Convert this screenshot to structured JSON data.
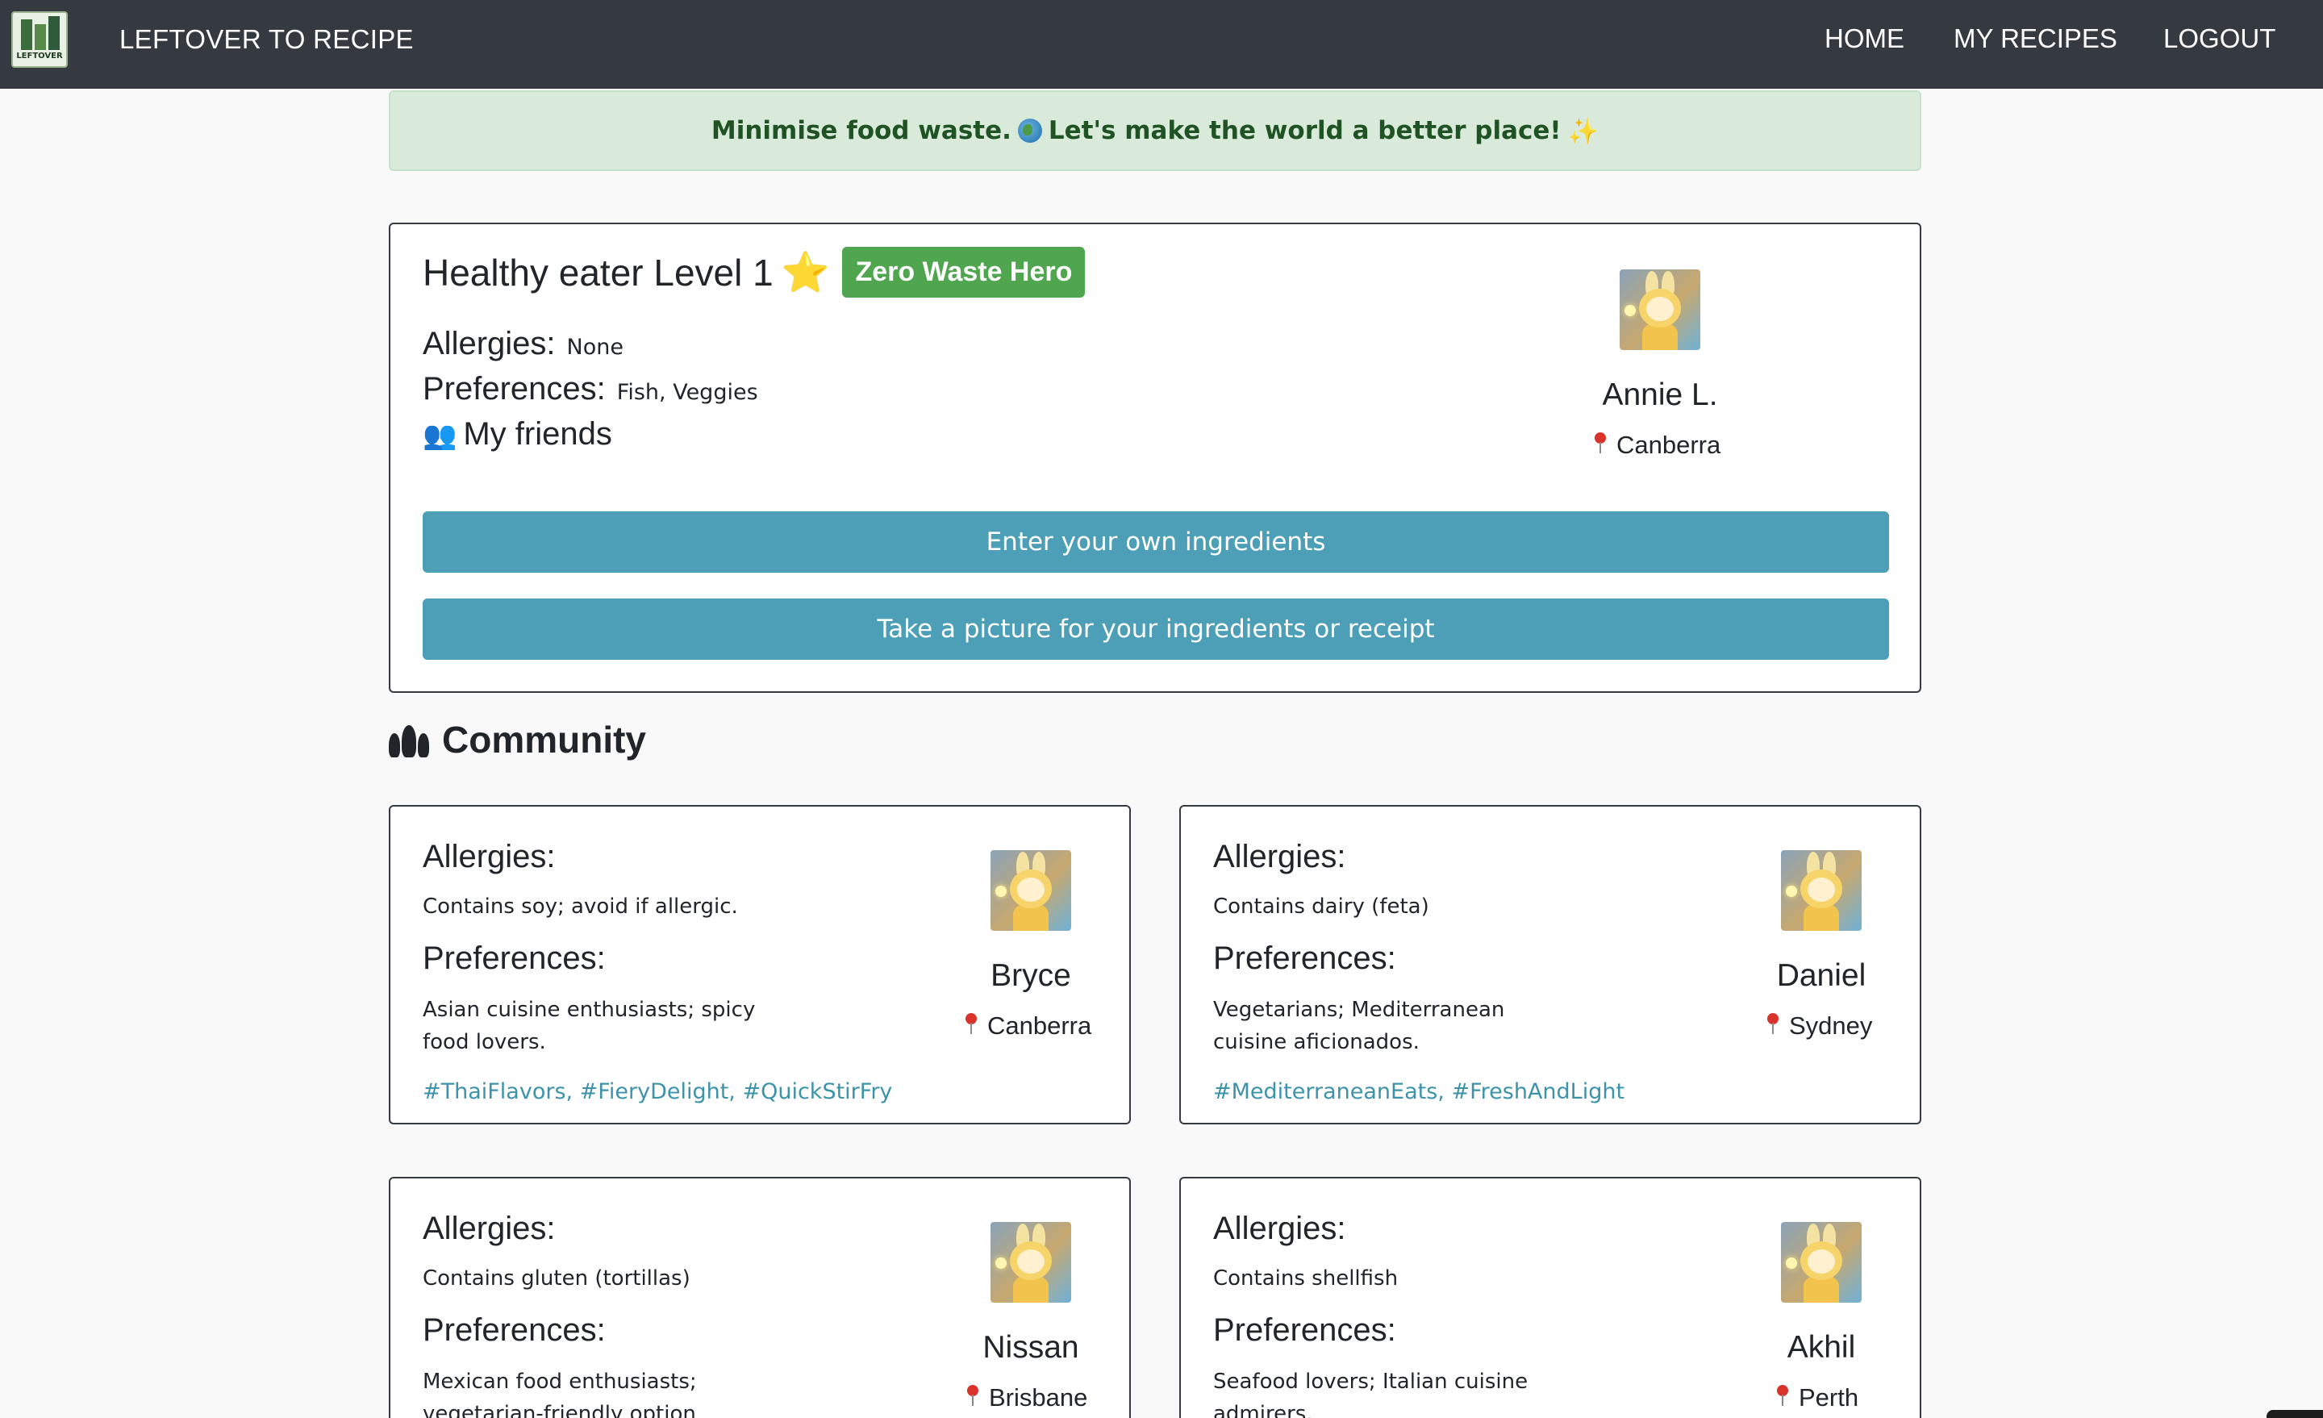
{
  "app": {
    "brand": "LEFTOVER TO RECIPE",
    "logo_text": "LEFTOVER"
  },
  "nav": {
    "home": "HOME",
    "my_recipes": "MY RECIPES",
    "logout": "LOGOUT"
  },
  "banner": {
    "part1": "Minimise food waste.",
    "part2": "Let's make the world a better place!",
    "sparkle": "✨"
  },
  "profile": {
    "level": "Healthy eater Level 1",
    "star": "⭐",
    "badge": "Zero Waste Hero",
    "allergies_label": "Allergies:",
    "allergies_value": "None",
    "preferences_label": "Preferences:",
    "preferences_value": "Fish, Veggies",
    "friends_label": "My friends",
    "name": "Annie L.",
    "location": "Canberra",
    "btn_enter": "Enter your own ingredients",
    "btn_picture": "Take a picture for your ingredients or receipt"
  },
  "community": {
    "title": "Community",
    "allergies_label": "Allergies:",
    "preferences_label": "Preferences:",
    "members": [
      {
        "name": "Bryce",
        "location": "Canberra",
        "allergies": "Contains soy; avoid if allergic.",
        "pref_line1": "Asian cuisine enthusiasts; spicy",
        "pref_line2": "food lovers.",
        "tags": "#ThaiFlavors, #FieryDelight, #QuickStirFry"
      },
      {
        "name": "Daniel",
        "location": "Sydney",
        "allergies": "Contains dairy (feta)",
        "pref_line1": "Vegetarians; Mediterranean",
        "pref_line2": "cuisine aficionados.",
        "tags": "#MediterraneanEats, #FreshAndLight"
      },
      {
        "name": "Nissan",
        "location": "Brisbane",
        "allergies": "Contains gluten (tortillas)",
        "pref_line1": "Mexican food enthusiasts;",
        "pref_line2": "vegetarian-friendly option",
        "tags": ""
      },
      {
        "name": "Akhil",
        "location": "Perth",
        "allergies": "Contains shellfish",
        "pref_line1": "Seafood lovers; Italian cuisine",
        "pref_line2": "admirers.",
        "tags": ""
      }
    ]
  }
}
